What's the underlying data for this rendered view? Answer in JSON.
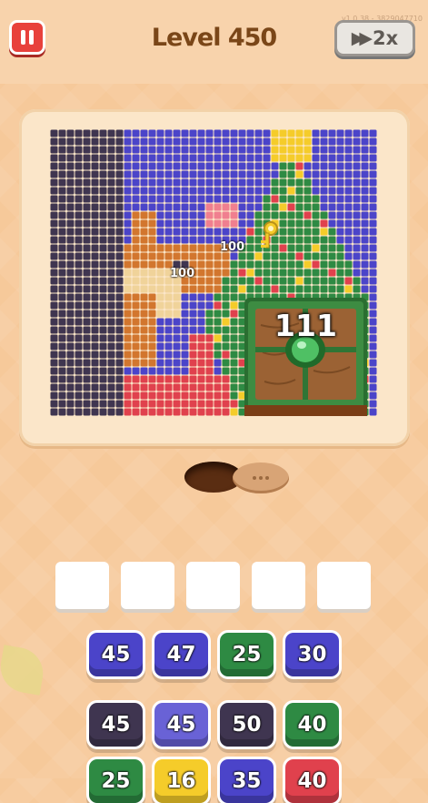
{
  "header": {
    "level_title": "Level 450",
    "speed_label": "2x",
    "build_info": "v1.0.38 - 3829047710"
  },
  "icons": {
    "pause": "pause-icon",
    "speed": "fast-forward-icon",
    "key": "key-icon"
  },
  "colors": {
    "purple": "#4b44c9",
    "dark": "#3f3550",
    "red": "#e0414d",
    "green": "#2e8a43",
    "orange": "#d2762e",
    "skin": "#f0d39a",
    "yellow": "#f5cc2a",
    "pink": "#f07f8f",
    "white": "#f2f2f2"
  },
  "board": {
    "pins": [
      "100",
      "100"
    ],
    "crate_count": "111"
  },
  "slots": [
    "",
    "",
    "",
    "",
    ""
  ],
  "blocks": [
    {
      "value": "45",
      "color": "#4b44c9"
    },
    {
      "value": "47",
      "color": "#4b44c9"
    },
    {
      "value": "25",
      "color": "#2e8a43"
    },
    {
      "value": "30",
      "color": "#4b44c9"
    },
    {
      "value": "45",
      "color": "#3f3550"
    },
    {
      "value": "45",
      "color": "#6962d6"
    },
    {
      "value": "50",
      "color": "#3f3550"
    },
    {
      "value": "40",
      "color": "#2e8a43"
    },
    {
      "value": "25",
      "color": "#2e8a43"
    },
    {
      "value": "16",
      "color": "#f5cc2a"
    },
    {
      "value": "35",
      "color": "#4b44c9"
    },
    {
      "value": "40",
      "color": "#e0414d"
    }
  ]
}
